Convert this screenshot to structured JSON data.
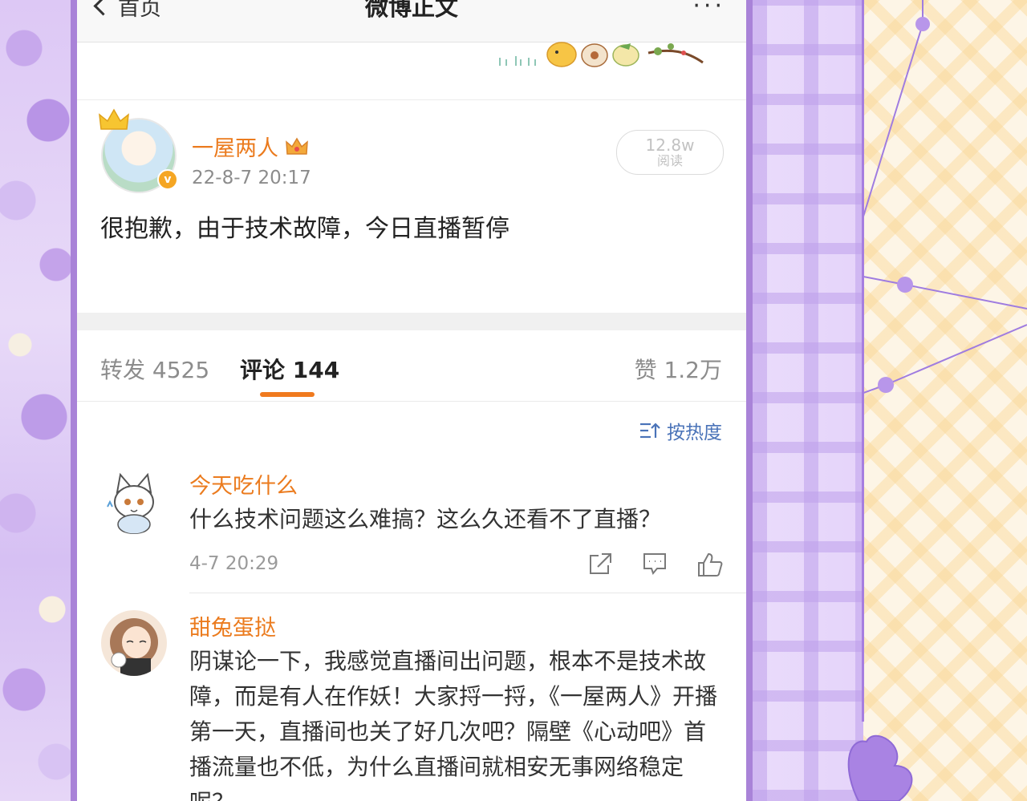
{
  "nav": {
    "back_label": "首页",
    "title": "微博正文",
    "more_label": "···"
  },
  "post": {
    "author": "一屋两人",
    "time": "22-8-7 20:17",
    "reads_value": "12.8w",
    "reads_label": "阅读",
    "text": "很抱歉，由于技术故障，今日直播暂停"
  },
  "tabs": [
    {
      "label": "转发 4525",
      "active": false
    },
    {
      "label": "评论 144",
      "active": true
    },
    {
      "label": "赞 1.2万",
      "active": false
    }
  ],
  "sort": {
    "label": "按热度"
  },
  "comments": [
    {
      "name": "今天吃什么",
      "text": "什么技术问题这么难搞？这么久还看不了直播？",
      "time": "4-7 20:29"
    },
    {
      "name": "甜兔蛋挞",
      "text": "阴谋论一下，我感觉直播间出问题，根本不是技术故障，而是有人在作妖！大家捋一捋，《一屋两人》开播第一天，直播间也关了好几次吧？隔壁《心动吧》首播流量也不低，为什么直播间就相安无事网络稳定呢？"
    }
  ],
  "colors": {
    "accent_orange": "#eb7b1e",
    "tab_underline": "#f07a1e",
    "link_blue": "#4a73b8",
    "frame_purple": "#a983d8"
  },
  "icons": [
    "back-chevron-icon",
    "more-icon",
    "crown-icon",
    "verified-icon",
    "sort-icon",
    "share-icon",
    "comment-icon",
    "like-icon"
  ]
}
